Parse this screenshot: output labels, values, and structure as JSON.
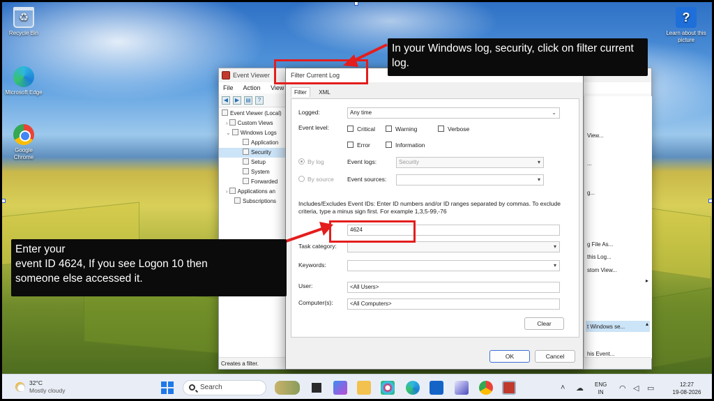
{
  "desktop_icons": [
    {
      "name": "recycle-bin",
      "label": "Recycle Bin"
    },
    {
      "name": "edge",
      "label": "Microsoft Edge"
    },
    {
      "name": "chrome",
      "label": "Google Chrome"
    },
    {
      "name": "learn",
      "label": "Learn about this picture"
    }
  ],
  "event_viewer": {
    "title": "Event Viewer",
    "menu": [
      "File",
      "Action",
      "View"
    ],
    "tree": [
      {
        "label": "Event Viewer (Local)"
      },
      {
        "label": "Custom Views"
      },
      {
        "label": "Windows Logs"
      },
      {
        "label": "Application"
      },
      {
        "label": "Security"
      },
      {
        "label": "Setup"
      },
      {
        "label": "System"
      },
      {
        "label": "Forwarded"
      },
      {
        "label": "Applications an"
      },
      {
        "label": "Subscriptions"
      }
    ],
    "status": "Creates a filter.",
    "actions": [
      "View...",
      "...",
      "g...",
      "g File As...",
      "this Log...",
      "stom View...",
      "t Windows se...",
      "his Event...",
      "vents..."
    ]
  },
  "dialog": {
    "title": "Filter Current Log",
    "tabs": [
      "Filter",
      "XML"
    ],
    "logged_label": "Logged:",
    "logged_value": "Any time",
    "event_level_label": "Event level:",
    "levels": [
      "Critical",
      "Warning",
      "Verbose",
      "Error",
      "Information"
    ],
    "by_log": "By log",
    "by_source": "By source",
    "event_logs_label": "Event logs:",
    "event_logs_value": "Security",
    "event_sources_label": "Event sources:",
    "includes_text": "Includes/Excludes Event IDs: Enter ID numbers and/or ID ranges separated by commas. To exclude criteria, type a minus sign first. For example 1,3,5-99,-76",
    "event_id_value": "4624",
    "task_category_label": "Task category:",
    "keywords_label": "Keywords:",
    "user_label": "User:",
    "user_value": "<All Users>",
    "computers_label": "Computer(s):",
    "computers_value": "<All Computers>",
    "clear_label": "Clear",
    "ok_label": "OK",
    "cancel_label": "Cancel"
  },
  "annotations": {
    "top": "In your Windows log, security, click on filter current log.",
    "left_line1": "Enter your",
    "left_line2": "event ID 4624, If you see Logon 10 then",
    "left_line3": "someone else accessed it."
  },
  "taskbar": {
    "temp": "32°C",
    "weather": "Mostly cloudy",
    "search": "Search",
    "lang1": "ENG",
    "lang2": "IN",
    "time": "12:27",
    "date": "19-08-2026"
  },
  "colors": {
    "annotation_red": "#e41d1d",
    "accent": "#3d6fd8"
  }
}
